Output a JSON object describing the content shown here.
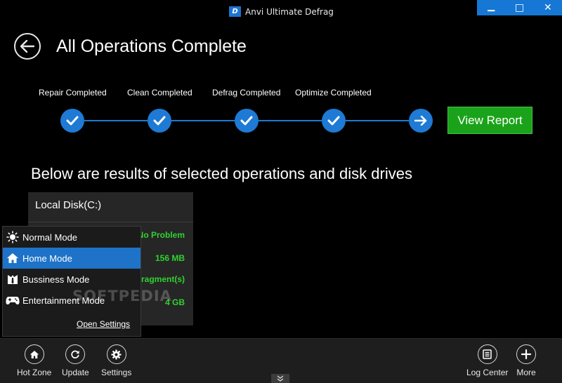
{
  "window": {
    "title": "Anvi Ultimate Defrag",
    "logo_letter": "D",
    "minimize_glyph": "▁",
    "maximize_glyph": "□",
    "close_glyph": "✕"
  },
  "header": {
    "title": "All Operations Complete",
    "back_icon": "arrow-left-icon"
  },
  "steps": [
    {
      "label": "Repair Completed",
      "status": "complete"
    },
    {
      "label": "Clean Completed",
      "status": "complete"
    },
    {
      "label": "Defrag Completed",
      "status": "complete"
    },
    {
      "label": "Optimize Completed",
      "status": "complete"
    },
    {
      "label": "",
      "status": "next"
    }
  ],
  "view_report_label": "View Report",
  "results_heading": "Below are results of selected operations and disk drives",
  "disk": {
    "name": "Local Disk(C:)",
    "values": [
      "No Problem",
      "156 MB",
      "fragment(s)",
      "4 GB"
    ]
  },
  "mode_menu": {
    "items": [
      {
        "label": "Normal Mode",
        "icon": "sun-icon",
        "active": false
      },
      {
        "label": "Home Mode",
        "icon": "home-icon",
        "active": true
      },
      {
        "label": "Bussiness Mode",
        "icon": "business-suit-icon",
        "active": false
      },
      {
        "label": "Entertainment Mode",
        "icon": "gamepad-icon",
        "active": false
      }
    ],
    "open_settings": "Open Settings"
  },
  "watermark": "SOFTPEDIA",
  "bottom_bar": {
    "left": [
      {
        "label": "Hot Zone",
        "icon": "home-icon"
      },
      {
        "label": "Update",
        "icon": "refresh-icon"
      },
      {
        "label": "Settings",
        "icon": "gear-icon"
      }
    ],
    "right": [
      {
        "label": "Log Center",
        "icon": "log-icon"
      },
      {
        "label": "More",
        "icon": "plus-icon"
      }
    ],
    "collapse_icon": "chevron-double-down-icon"
  },
  "colors": {
    "accent": "#1e7ad4",
    "success": "#1aa31a",
    "success_text": "#2fd22f",
    "background": "#000000"
  }
}
